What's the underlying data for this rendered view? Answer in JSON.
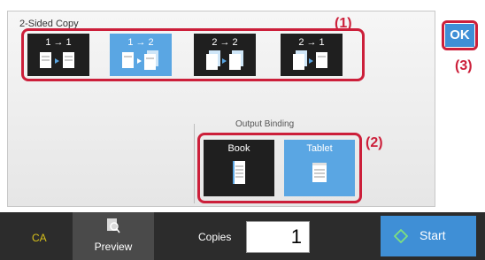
{
  "panel": {
    "title": "2-Sided Copy"
  },
  "modes": [
    {
      "label": "1 → 1",
      "selected": false
    },
    {
      "label": "1 → 2",
      "selected": true
    },
    {
      "label": "2 → 2",
      "selected": false
    },
    {
      "label": "2 → 1",
      "selected": false
    }
  ],
  "binding": {
    "title": "Output Binding",
    "options": [
      {
        "label": "Book",
        "selected": false
      },
      {
        "label": "Tablet",
        "selected": true
      }
    ]
  },
  "callouts": {
    "c1": "(1)",
    "c2": "(2)",
    "c3": "(3)"
  },
  "ok_label": "OK",
  "bottom": {
    "ca_label": "CA",
    "preview_label": "Preview",
    "copies_label": "Copies",
    "copies_value": "1",
    "start_label": "Start"
  },
  "colors": {
    "accent": "#3f8fd6",
    "selected": "#5aa6e3",
    "highlight": "#cc1f3a",
    "dark": "#1f1f1f"
  }
}
